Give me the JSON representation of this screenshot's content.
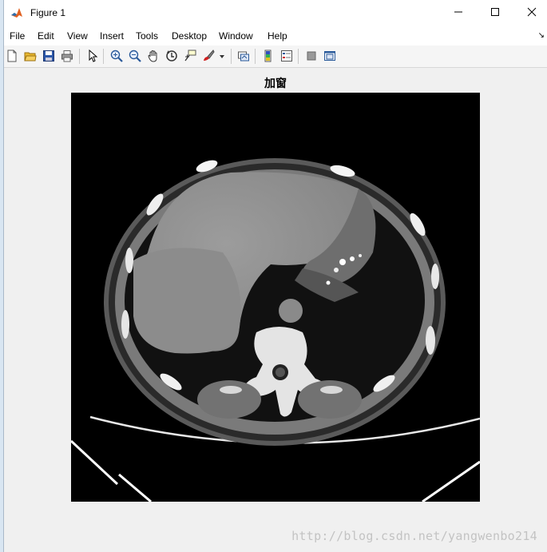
{
  "window": {
    "title": "Figure 1",
    "controls": {
      "minimize": "minimize",
      "maximize": "maximize",
      "close": "close"
    }
  },
  "menu": {
    "items": [
      "File",
      "Edit",
      "View",
      "Insert",
      "Tools",
      "Desktop",
      "Window",
      "Help"
    ],
    "dock_arrow": "↘"
  },
  "toolbar": {
    "buttons": [
      "new-figure-icon",
      "open-file-icon",
      "save-icon",
      "print-icon",
      "edit-plot-arrow-icon",
      "zoom-in-icon",
      "zoom-out-icon",
      "pan-hand-icon",
      "rotate-3d-icon",
      "data-cursor-icon",
      "brush-icon",
      "brush-dropdown-icon",
      "link-plot-icon",
      "insert-colorbar-icon",
      "insert-legend-icon",
      "hide-plot-tools-icon",
      "show-plot-tools-icon"
    ]
  },
  "axes": {
    "title": "加窗",
    "image": "ct-abdomen-scan"
  },
  "watermark": "http://blog.csdn.net/yangwenbo214",
  "colors": {
    "titlebar": "#ffffff",
    "figure_bg": "#f0f0f0",
    "image_bg": "#000000",
    "watermark": "#c3c3c3"
  }
}
